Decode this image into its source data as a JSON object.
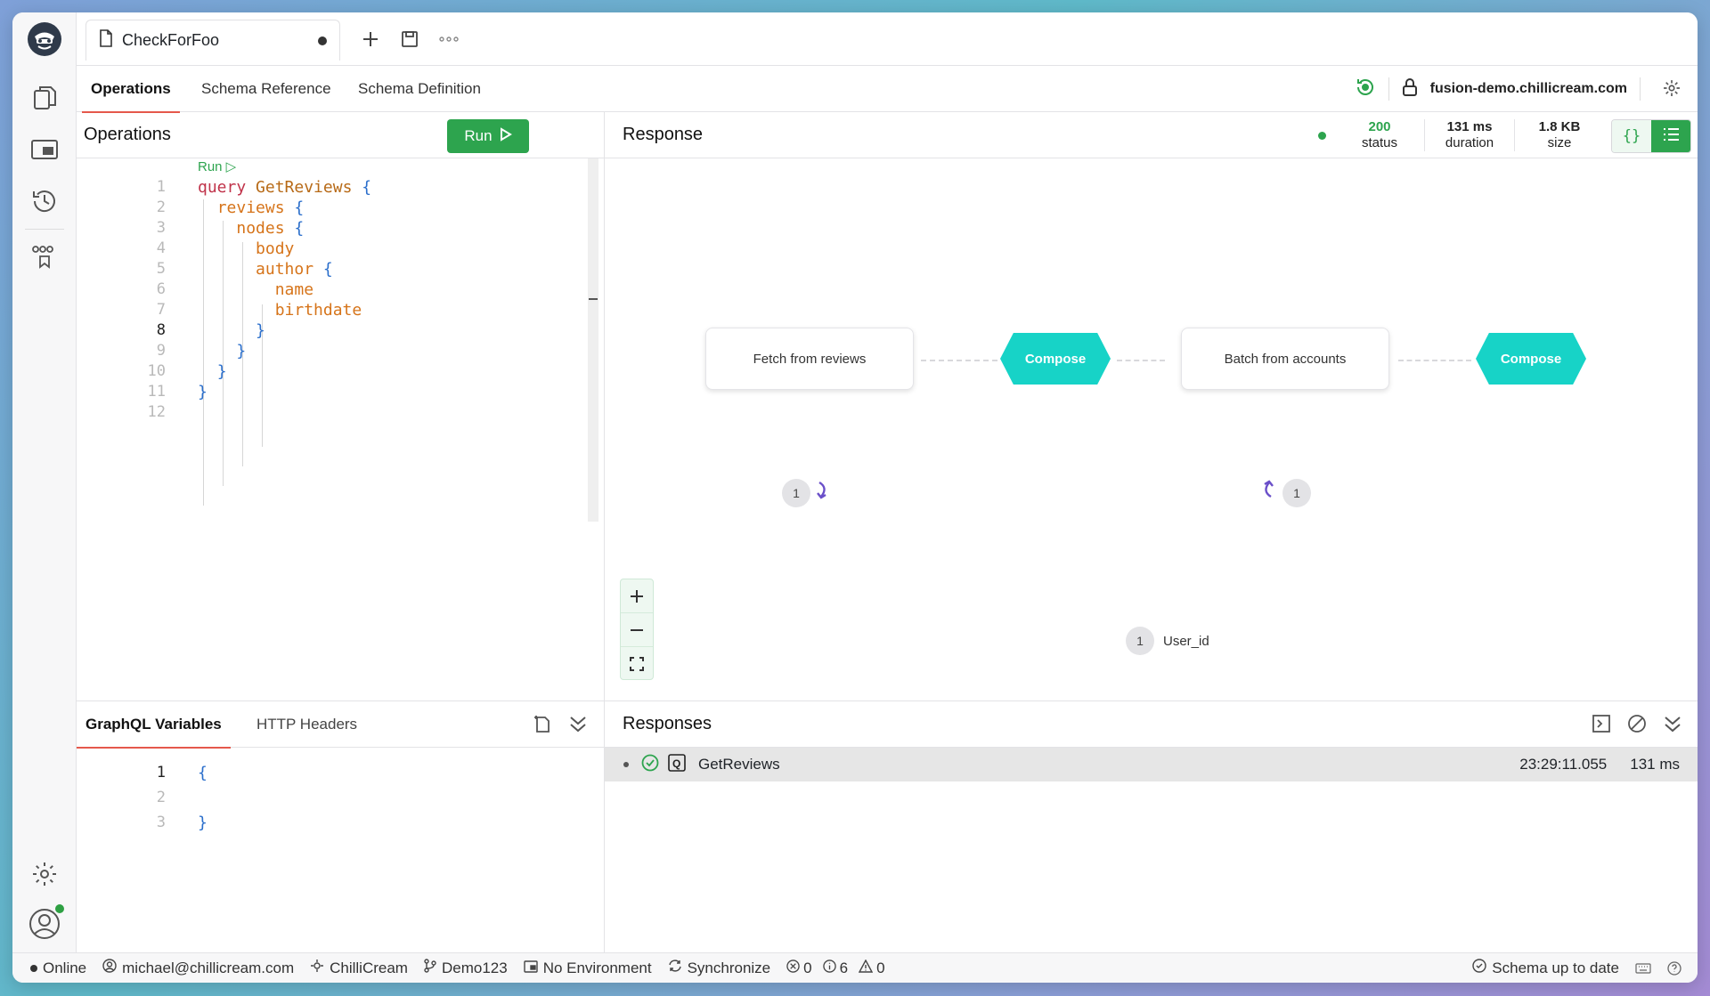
{
  "document_tab": {
    "title": "CheckForFoo"
  },
  "nav": {
    "tabs": [
      "Operations",
      "Schema Reference",
      "Schema Definition"
    ],
    "endpoint": "fusion-demo.chillicream.com"
  },
  "operations": {
    "title": "Operations",
    "run_label": "Run",
    "codelens": "Run ▷",
    "lines": [
      "1",
      "2",
      "3",
      "4",
      "5",
      "6",
      "7",
      "8",
      "9",
      "10",
      "11",
      "12"
    ]
  },
  "response": {
    "title": "Response",
    "status_value": "200",
    "status_label": "status",
    "duration_value": "131 ms",
    "duration_label": "duration",
    "size_value": "1.8 KB",
    "size_label": "size",
    "status_color": "#2da44e"
  },
  "plan": {
    "node1": "Fetch from reviews",
    "compose1": "Compose",
    "node2": "Batch from accounts",
    "compose2": "Compose",
    "badge1": "1",
    "badge2": "1",
    "badge3": "1",
    "var_label": "User_id",
    "accent": "#17d3c7"
  },
  "variables": {
    "tabs": [
      "GraphQL Variables",
      "HTTP Headers"
    ],
    "lines": [
      "1",
      "2",
      "3"
    ],
    "line1": "{",
    "line3": "}"
  },
  "responses": {
    "title": "Responses",
    "item": {
      "name": "GetReviews",
      "time": "23:29:11.055",
      "duration": "131 ms"
    }
  },
  "status_bar": {
    "online": "Online",
    "user": "michael@chillicream.com",
    "org": "ChilliCream",
    "branch": "Demo123",
    "environment": "No Environment",
    "sync": "Synchronize",
    "errors": "0",
    "infos": "6",
    "warnings": "0",
    "schema": "Schema up to date"
  }
}
